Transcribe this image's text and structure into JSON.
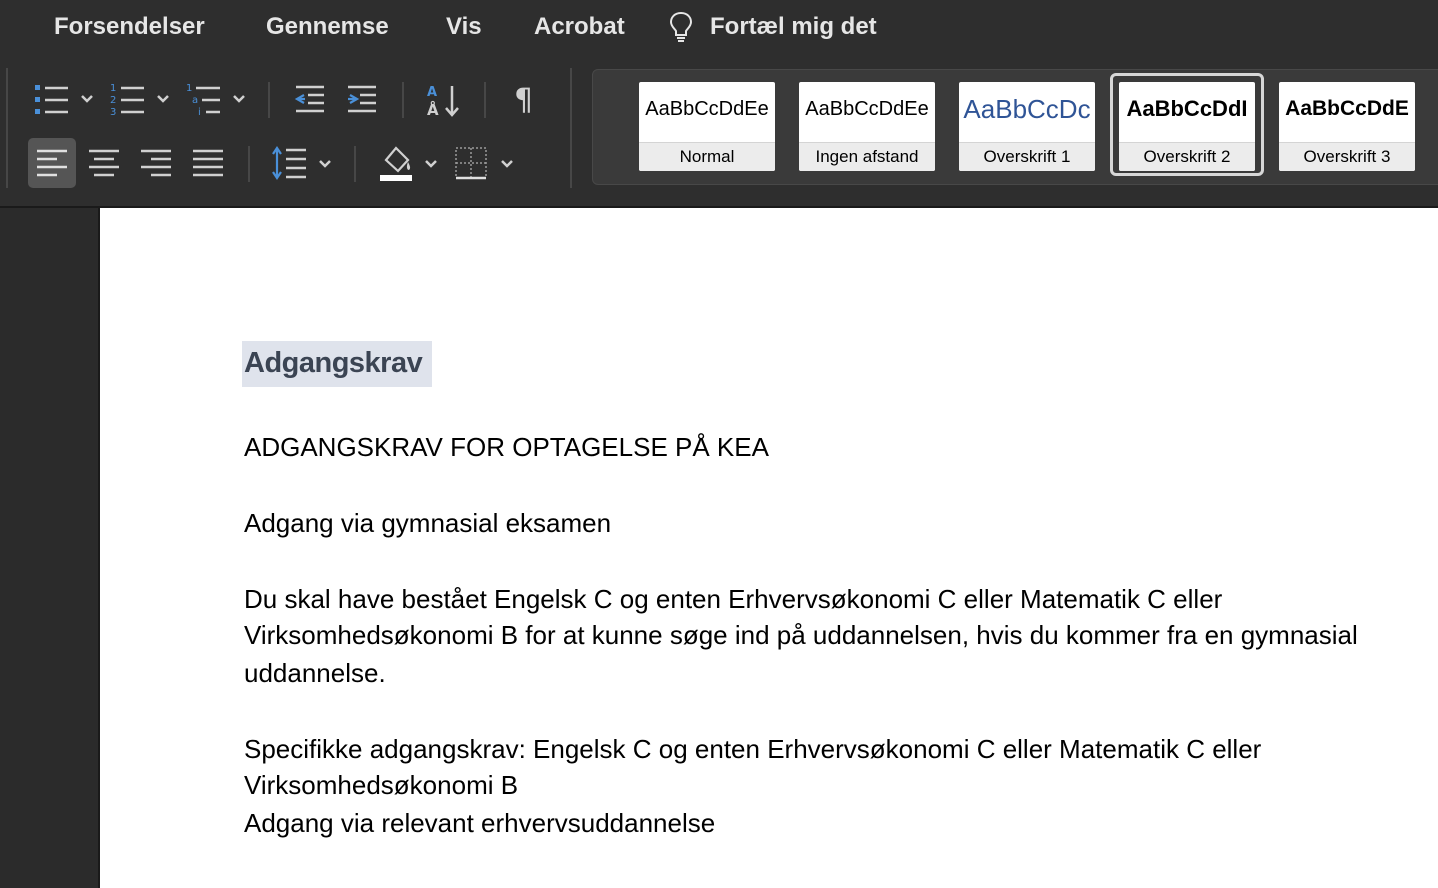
{
  "menu": {
    "items": [
      "Forsendelser",
      "Gennemse",
      "Vis",
      "Acrobat"
    ],
    "tell_me": "Fortæl mig det"
  },
  "ribbon": {
    "styles": [
      {
        "sample": "AaBbCcDdEe",
        "label": "Normal"
      },
      {
        "sample": "AaBbCcDdEe",
        "label": "Ingen afstand"
      },
      {
        "sample": "AaBbCcDc",
        "label": "Overskrift 1"
      },
      {
        "sample": "AaBbCcDdI",
        "label": "Overskrift 2"
      },
      {
        "sample": "AaBbCcDdE",
        "label": "Overskrift 3"
      }
    ],
    "selected_style": "Overskrift 2",
    "colors": {
      "accent_blue": "#4a90d9",
      "heading1_blue": "#2f5496"
    }
  },
  "document": {
    "heading": "Adgangskrav",
    "lines": [
      "ADGANGSKRAV FOR OPTAGELSE PÅ KEA",
      "Adgang via gymnasial eksamen",
      "Du skal have bestået Engelsk C og enten Erhvervsøkonomi C eller Matematik C eller",
      "Virksomhedsøkonomi B for at kunne søge ind på uddannelsen, hvis du kommer fra en gymnasial",
      "uddannelse.",
      "Specifikke adgangskrav: Engelsk C og enten Erhvervsøkonomi C eller Matematik C eller",
      "Virksomhedsøkonomi B",
      "Adgang via relevant erhvervsuddannelse"
    ]
  }
}
